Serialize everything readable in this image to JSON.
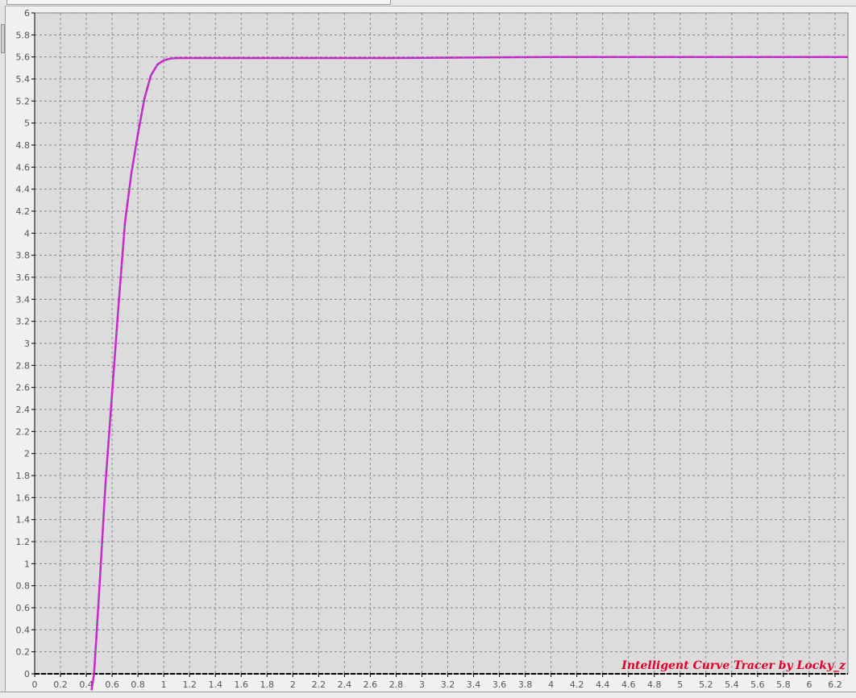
{
  "colors": {
    "plot_background": "#dcdcdc",
    "grid": "#8a8a8a",
    "curve": "#cc22cc",
    "curve_dash": "#33aa88",
    "axis": "#000000",
    "watermark": "#e0002a"
  },
  "watermark": "Intelligent Curve Tracer by Locky_z",
  "chart_data": {
    "type": "line",
    "title": "",
    "xlabel": "",
    "ylabel": "",
    "xlim": [
      0,
      6.3
    ],
    "ylim": [
      0,
      6
    ],
    "grid": true,
    "x_ticks": [
      0,
      0.2,
      0.4,
      0.6,
      0.8,
      1,
      1.2,
      1.4,
      1.6,
      1.8,
      2,
      2.2,
      2.4,
      2.6,
      2.8,
      3,
      3.2,
      3.4,
      3.6,
      3.8,
      4,
      4.2,
      4.4,
      4.6,
      4.8,
      5,
      5.2,
      5.4,
      5.6,
      5.8,
      6,
      6.2
    ],
    "x_tick_labels": [
      "0",
      "0.2",
      "0.4",
      "0.6",
      "0.8",
      "1",
      "1.2",
      "1.4",
      "1.6",
      "1.8",
      "2",
      "2.2",
      "2.4",
      "2.6",
      "2.8",
      "3",
      "3.2",
      "3.4",
      "3.6",
      "3.8",
      "4",
      "4.2",
      "4.4",
      "4.6",
      "4.8",
      "5",
      "5.2",
      "5.4",
      "5.6",
      "5.8",
      "6",
      "6.2"
    ],
    "y_ticks": [
      0,
      0.2,
      0.4,
      0.6,
      0.8,
      1,
      1.2,
      1.4,
      1.6,
      1.8,
      2,
      2.2,
      2.4,
      2.6,
      2.8,
      3,
      3.2,
      3.4,
      3.6,
      3.8,
      4,
      4.2,
      4.4,
      4.6,
      4.8,
      5,
      5.2,
      5.4,
      5.6,
      5.8,
      6
    ],
    "y_tick_labels": [
      "0",
      "0.2",
      "0.4",
      "0.6",
      "0.8",
      "1",
      "1.2",
      "1.4",
      "1.6",
      "1.8",
      "2",
      "2.2",
      "2.4",
      "2.6",
      "2.8",
      "3",
      "3.2",
      "3.4",
      "3.6",
      "3.8",
      "4",
      "4.2",
      "4.4",
      "4.6",
      "4.8",
      "5",
      "5.2",
      "5.4",
      "5.6",
      "5.8",
      "6"
    ],
    "series": [
      {
        "x": [
          0.44,
          0.46,
          0.5,
          0.55,
          0.6,
          0.65,
          0.7,
          0.75,
          0.8,
          0.85,
          0.9,
          0.95,
          1.0,
          1.05,
          1.1,
          1.2,
          1.5,
          2.0,
          2.8,
          4.0,
          5.0,
          6.3
        ],
        "y": [
          -0.15,
          0.0,
          0.75,
          1.75,
          2.55,
          3.35,
          4.1,
          4.55,
          4.9,
          5.22,
          5.43,
          5.53,
          5.57,
          5.585,
          5.59,
          5.59,
          5.59,
          5.59,
          5.59,
          5.6,
          5.6,
          5.6
        ]
      }
    ]
  }
}
